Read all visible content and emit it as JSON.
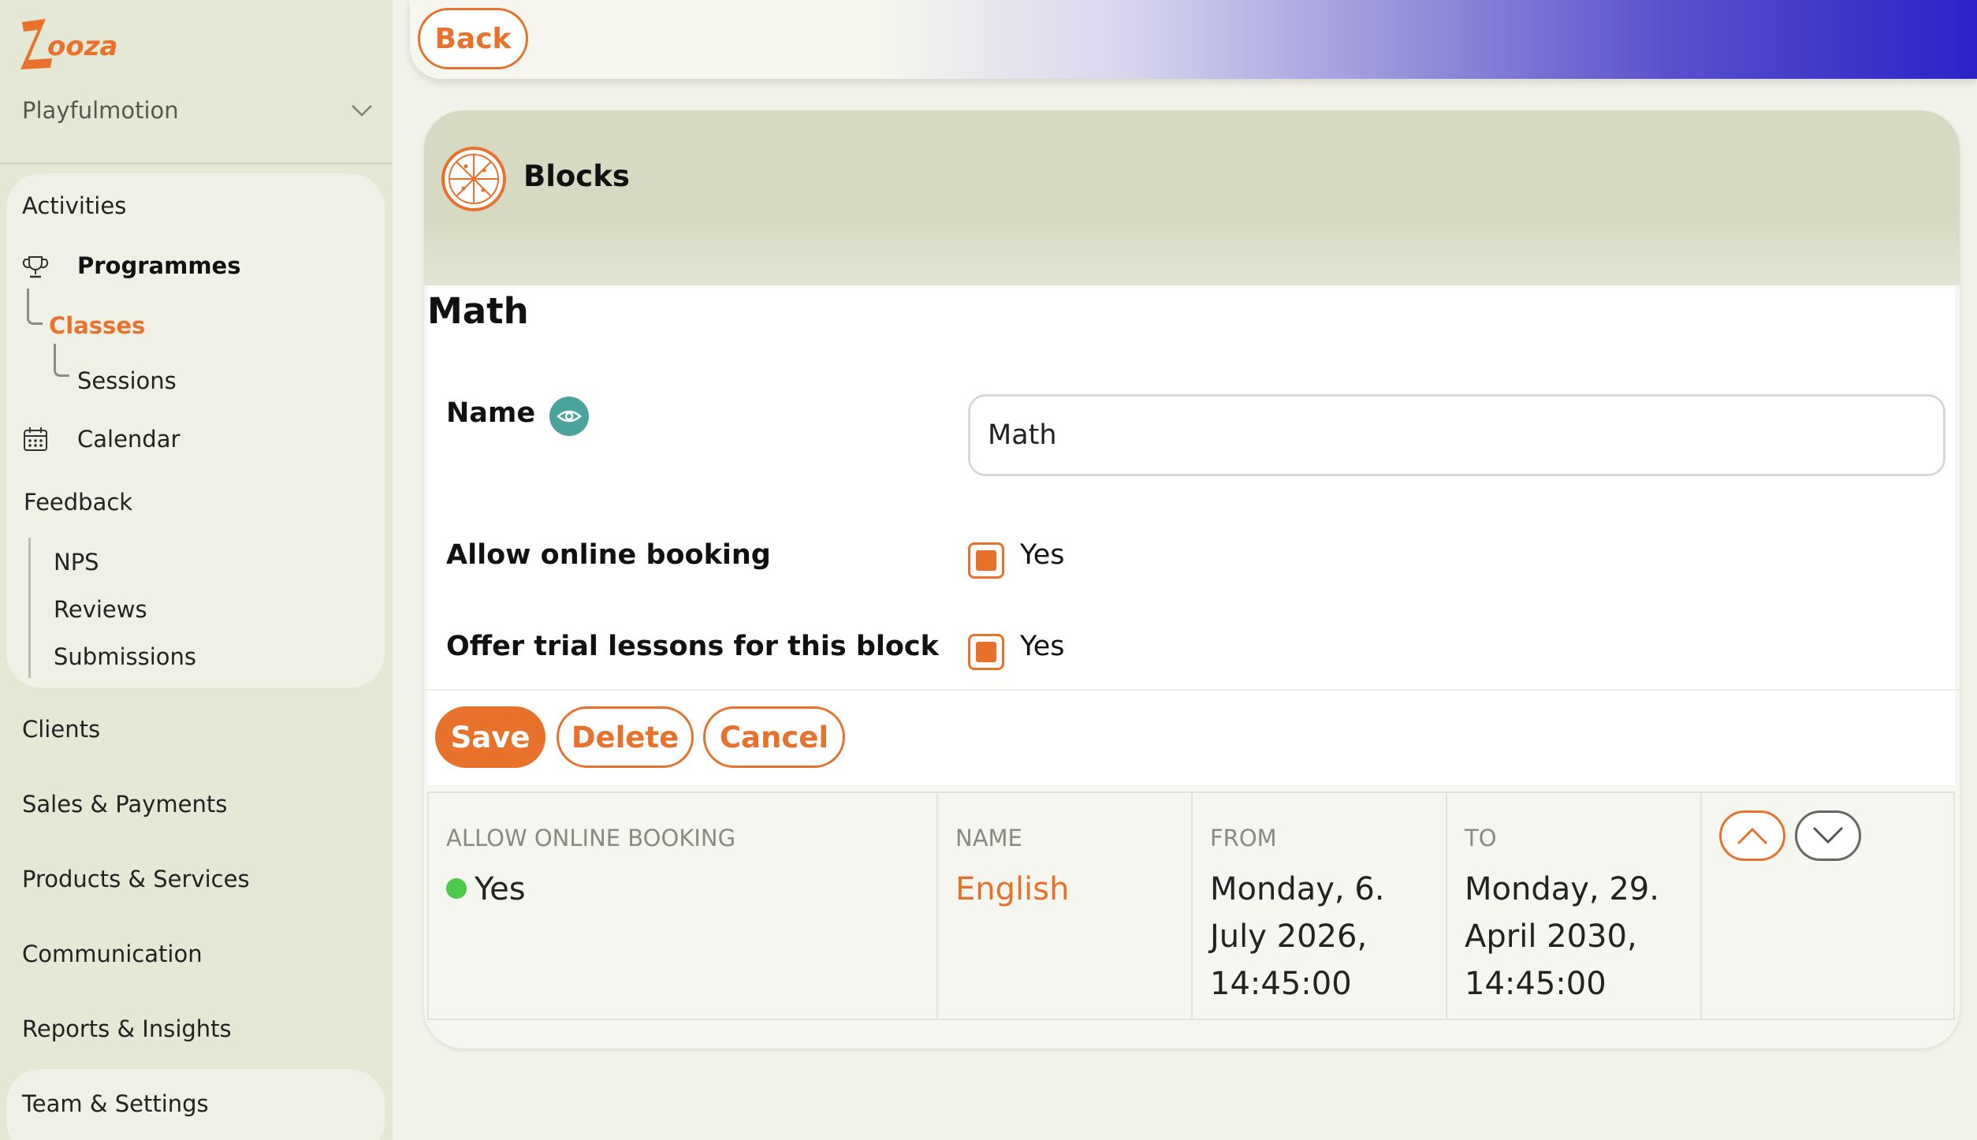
{
  "brand": {
    "logo_text": "ZOOZA",
    "accent": "#e8722c",
    "gradient_end": "#2a22c6"
  },
  "sidebar": {
    "org_name": "Playfulmotion",
    "items": {
      "activities": "Activities",
      "programmes": "Programmes",
      "classes": "Classes",
      "sessions": "Sessions",
      "calendar": "Calendar",
      "feedback": "Feedback",
      "nps": "NPS",
      "reviews": "Reviews",
      "submissions": "Submissions",
      "clients": "Clients",
      "sales_payments": "Sales & Payments",
      "products_services": "Products & Services",
      "communication": "Communication",
      "reports_insights": "Reports & Insights",
      "team_settings": "Team & Settings"
    }
  },
  "topbar": {
    "back_label": "Back"
  },
  "card": {
    "title": "Blocks",
    "edit": {
      "heading": "Math",
      "name_label": "Name",
      "name_value": "Math",
      "online_booking_label": "Allow online booking",
      "online_booking_value": "Yes",
      "trial_label": "Offer trial lessons for this block",
      "trial_value": "Yes",
      "save_label": "Save",
      "delete_label": "Delete",
      "cancel_label": "Cancel"
    },
    "table": {
      "headers": {
        "allow_online_booking": "ALLOW ONLINE BOOKING",
        "name": "NAME",
        "from": "FROM",
        "to": "TO"
      },
      "rows": [
        {
          "allow_online_booking": "Yes",
          "name": "English",
          "from_line1": "Monday, 6.",
          "from_line2": "July 2026,",
          "from_line3": "14:45:00",
          "to_line1": "Monday, 29.",
          "to_line2": "April 2030,",
          "to_line3": "14:45:00"
        }
      ]
    }
  }
}
